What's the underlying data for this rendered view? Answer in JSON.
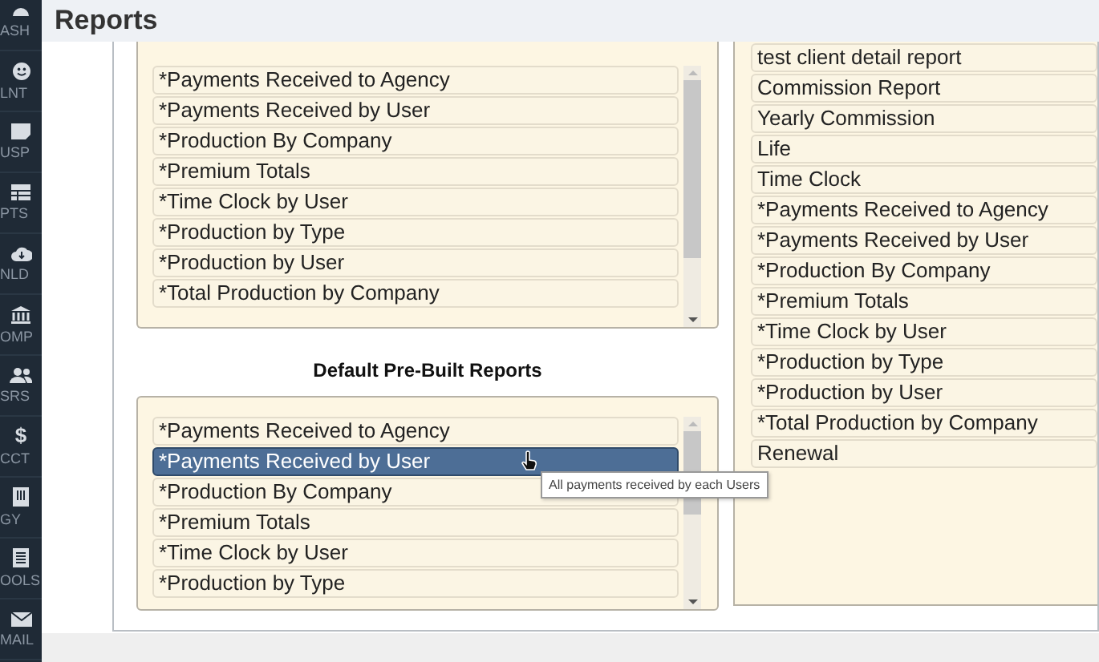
{
  "header": {
    "title": "Reports"
  },
  "sidebar": {
    "items": [
      {
        "label": "ASH"
      },
      {
        "label": "LNT"
      },
      {
        "label": "USP"
      },
      {
        "label": "PTS"
      },
      {
        "label": "NLD"
      },
      {
        "label": "OMP"
      },
      {
        "label": "SRS"
      },
      {
        "label": "CCT",
        "glyph": "$"
      },
      {
        "label": "GY"
      },
      {
        "label": "OOLS"
      },
      {
        "label": "MAIL"
      }
    ]
  },
  "custom_reports": {
    "items": [
      {
        "label": "*Payments Received to Agency",
        "selected": false
      },
      {
        "label": "*Payments Received by User",
        "selected": false
      },
      {
        "label": "*Production By Company",
        "selected": false
      },
      {
        "label": "*Premium Totals",
        "selected": false
      },
      {
        "label": "*Time Clock by User",
        "selected": false
      },
      {
        "label": "*Production by Type",
        "selected": false
      },
      {
        "label": "*Production by User",
        "selected": false
      },
      {
        "label": "*Total Production by Company",
        "selected": false
      }
    ]
  },
  "default_reports": {
    "heading": "Default Pre-Built Reports",
    "items": [
      {
        "label": "*Payments Received to Agency",
        "selected": false
      },
      {
        "label": "*Payments Received by User",
        "selected": true
      },
      {
        "label": "*Production By Company",
        "selected": false
      },
      {
        "label": "*Premium Totals",
        "selected": false
      },
      {
        "label": "*Time Clock by User",
        "selected": false
      },
      {
        "label": "*Production by Type",
        "selected": false
      }
    ]
  },
  "tooltip": "All payments received by each Users",
  "assigned_reports": {
    "items": [
      {
        "label": "test client detail report",
        "selected": false
      },
      {
        "label": "Commission Report",
        "selected": false
      },
      {
        "label": "Yearly Commission",
        "selected": false
      },
      {
        "label": "Life",
        "selected": false
      },
      {
        "label": "Time Clock",
        "selected": false
      },
      {
        "label": "*Payments Received to Agency",
        "selected": false
      },
      {
        "label": "*Payments Received by User",
        "selected": false
      },
      {
        "label": "*Production By Company",
        "selected": false
      },
      {
        "label": "*Premium Totals",
        "selected": false
      },
      {
        "label": "*Time Clock by User",
        "selected": false
      },
      {
        "label": "*Production by Type",
        "selected": false
      },
      {
        "label": "*Production by User",
        "selected": false
      },
      {
        "label": "*Total Production by Company",
        "selected": false
      },
      {
        "label": "Renewal",
        "selected": false
      }
    ]
  }
}
